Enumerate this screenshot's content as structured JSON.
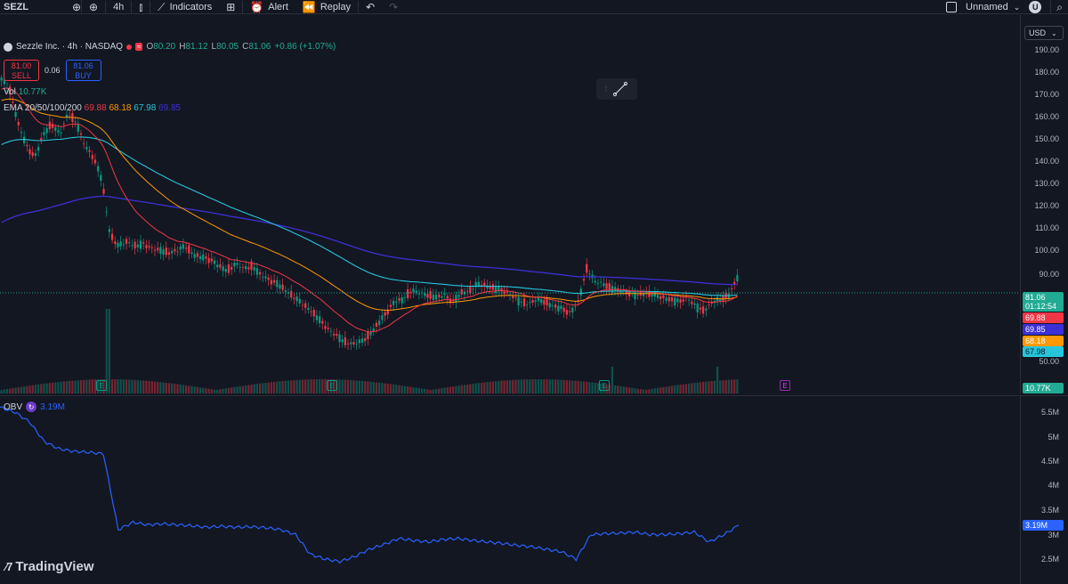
{
  "toolbar": {
    "symbol": "SEZL",
    "interval": "4h",
    "indicators_label": "Indicators",
    "alert_label": "Alert",
    "replay_label": "Replay",
    "layout_name": "Unnamed",
    "avatar_letter": "U"
  },
  "legend": {
    "name": "Sezzle Inc. · 4h · NASDAQ",
    "open_label": "O",
    "open": "80.20",
    "high_label": "H",
    "high": "81.12",
    "low_label": "L",
    "low": "80.05",
    "close_label": "C",
    "close": "81.06",
    "change": "+0.86 (+1.07%)"
  },
  "trade": {
    "sell_price": "81.00",
    "sell_label": "SELL",
    "spread": "0.06",
    "buy_price": "81.06",
    "buy_label": "BUY"
  },
  "volume": {
    "label": "Vol",
    "value": "10.77K"
  },
  "ema": {
    "label": "EMA 20/50/100/200",
    "v20": "69.88",
    "v50": "68.18",
    "v100": "67.98",
    "v200": "69.85",
    "colors": {
      "v20": "#f23645",
      "v50": "#ff9800",
      "v100": "#26c6da",
      "v200": "#3d2fd6"
    }
  },
  "price_axis": {
    "currency": "USD",
    "ticks": [
      "190.00",
      "180.00",
      "170.00",
      "160.00",
      "150.00",
      "140.00",
      "130.00",
      "120.00",
      "110.00",
      "100.00",
      "90.00",
      "50.00"
    ],
    "current_price": "81.06",
    "countdown": "01:12:54",
    "ema_tags": [
      "69.88",
      "69.85",
      "68.18",
      "67.98"
    ],
    "volume_tag": "10.77K"
  },
  "obv": {
    "label": "OBV",
    "value": "3.19M",
    "ticks": [
      "5.5M",
      "5M",
      "4.5M",
      "4M",
      "3.5M",
      "3M",
      "2.5M"
    ]
  },
  "earnings_marker": "E",
  "branding": {
    "name": "TradingView"
  },
  "chart_data": {
    "type": "candlestick",
    "price_range": [
      50,
      195
    ],
    "series": [
      {
        "name": "EMA 20",
        "color": "#f23645"
      },
      {
        "name": "EMA 50",
        "color": "#ff9800"
      },
      {
        "name": "EMA 100",
        "color": "#26c6da"
      },
      {
        "name": "EMA 200",
        "color": "#3d2fd6"
      },
      {
        "name": "OBV",
        "color": "#2962ff"
      }
    ],
    "close_path": [
      170,
      165,
      150,
      140,
      135,
      145,
      150,
      145,
      155,
      150,
      140,
      135,
      125,
      100,
      95,
      97,
      95,
      96,
      94,
      93,
      92,
      93,
      95,
      91,
      90,
      89,
      86,
      84,
      87,
      85,
      86,
      82,
      80,
      78,
      75,
      72,
      69,
      66,
      62,
      58,
      55,
      52,
      51,
      52,
      55,
      60,
      65,
      70,
      71,
      75,
      74,
      73,
      72,
      73,
      70,
      74,
      75,
      78,
      77,
      76,
      75,
      73,
      70,
      69,
      71,
      70,
      68,
      67,
      65,
      70,
      85,
      79,
      78,
      76,
      75,
      74,
      73,
      74,
      73,
      72,
      71,
      70,
      72,
      68,
      66,
      70,
      71,
      73,
      81
    ],
    "obv_path": [
      5.6,
      5.5,
      5.3,
      4.9,
      4.75,
      4.7,
      4.68,
      4.65,
      3.1,
      3.25,
      3.2,
      3.22,
      3.2,
      3.18,
      3.15,
      3.17,
      3.15,
      3.16,
      3.14,
      3.1,
      3.0,
      2.6,
      2.5,
      2.45,
      2.55,
      2.7,
      2.8,
      2.92,
      2.88,
      2.85,
      2.9,
      2.92,
      2.88,
      2.85,
      2.82,
      2.78,
      2.75,
      2.7,
      2.65,
      2.5,
      3.0,
      3.02,
      3.03,
      3.05,
      3.0,
      3.0,
      3.02,
      3.05,
      2.85,
      3.0,
      3.19
    ]
  }
}
